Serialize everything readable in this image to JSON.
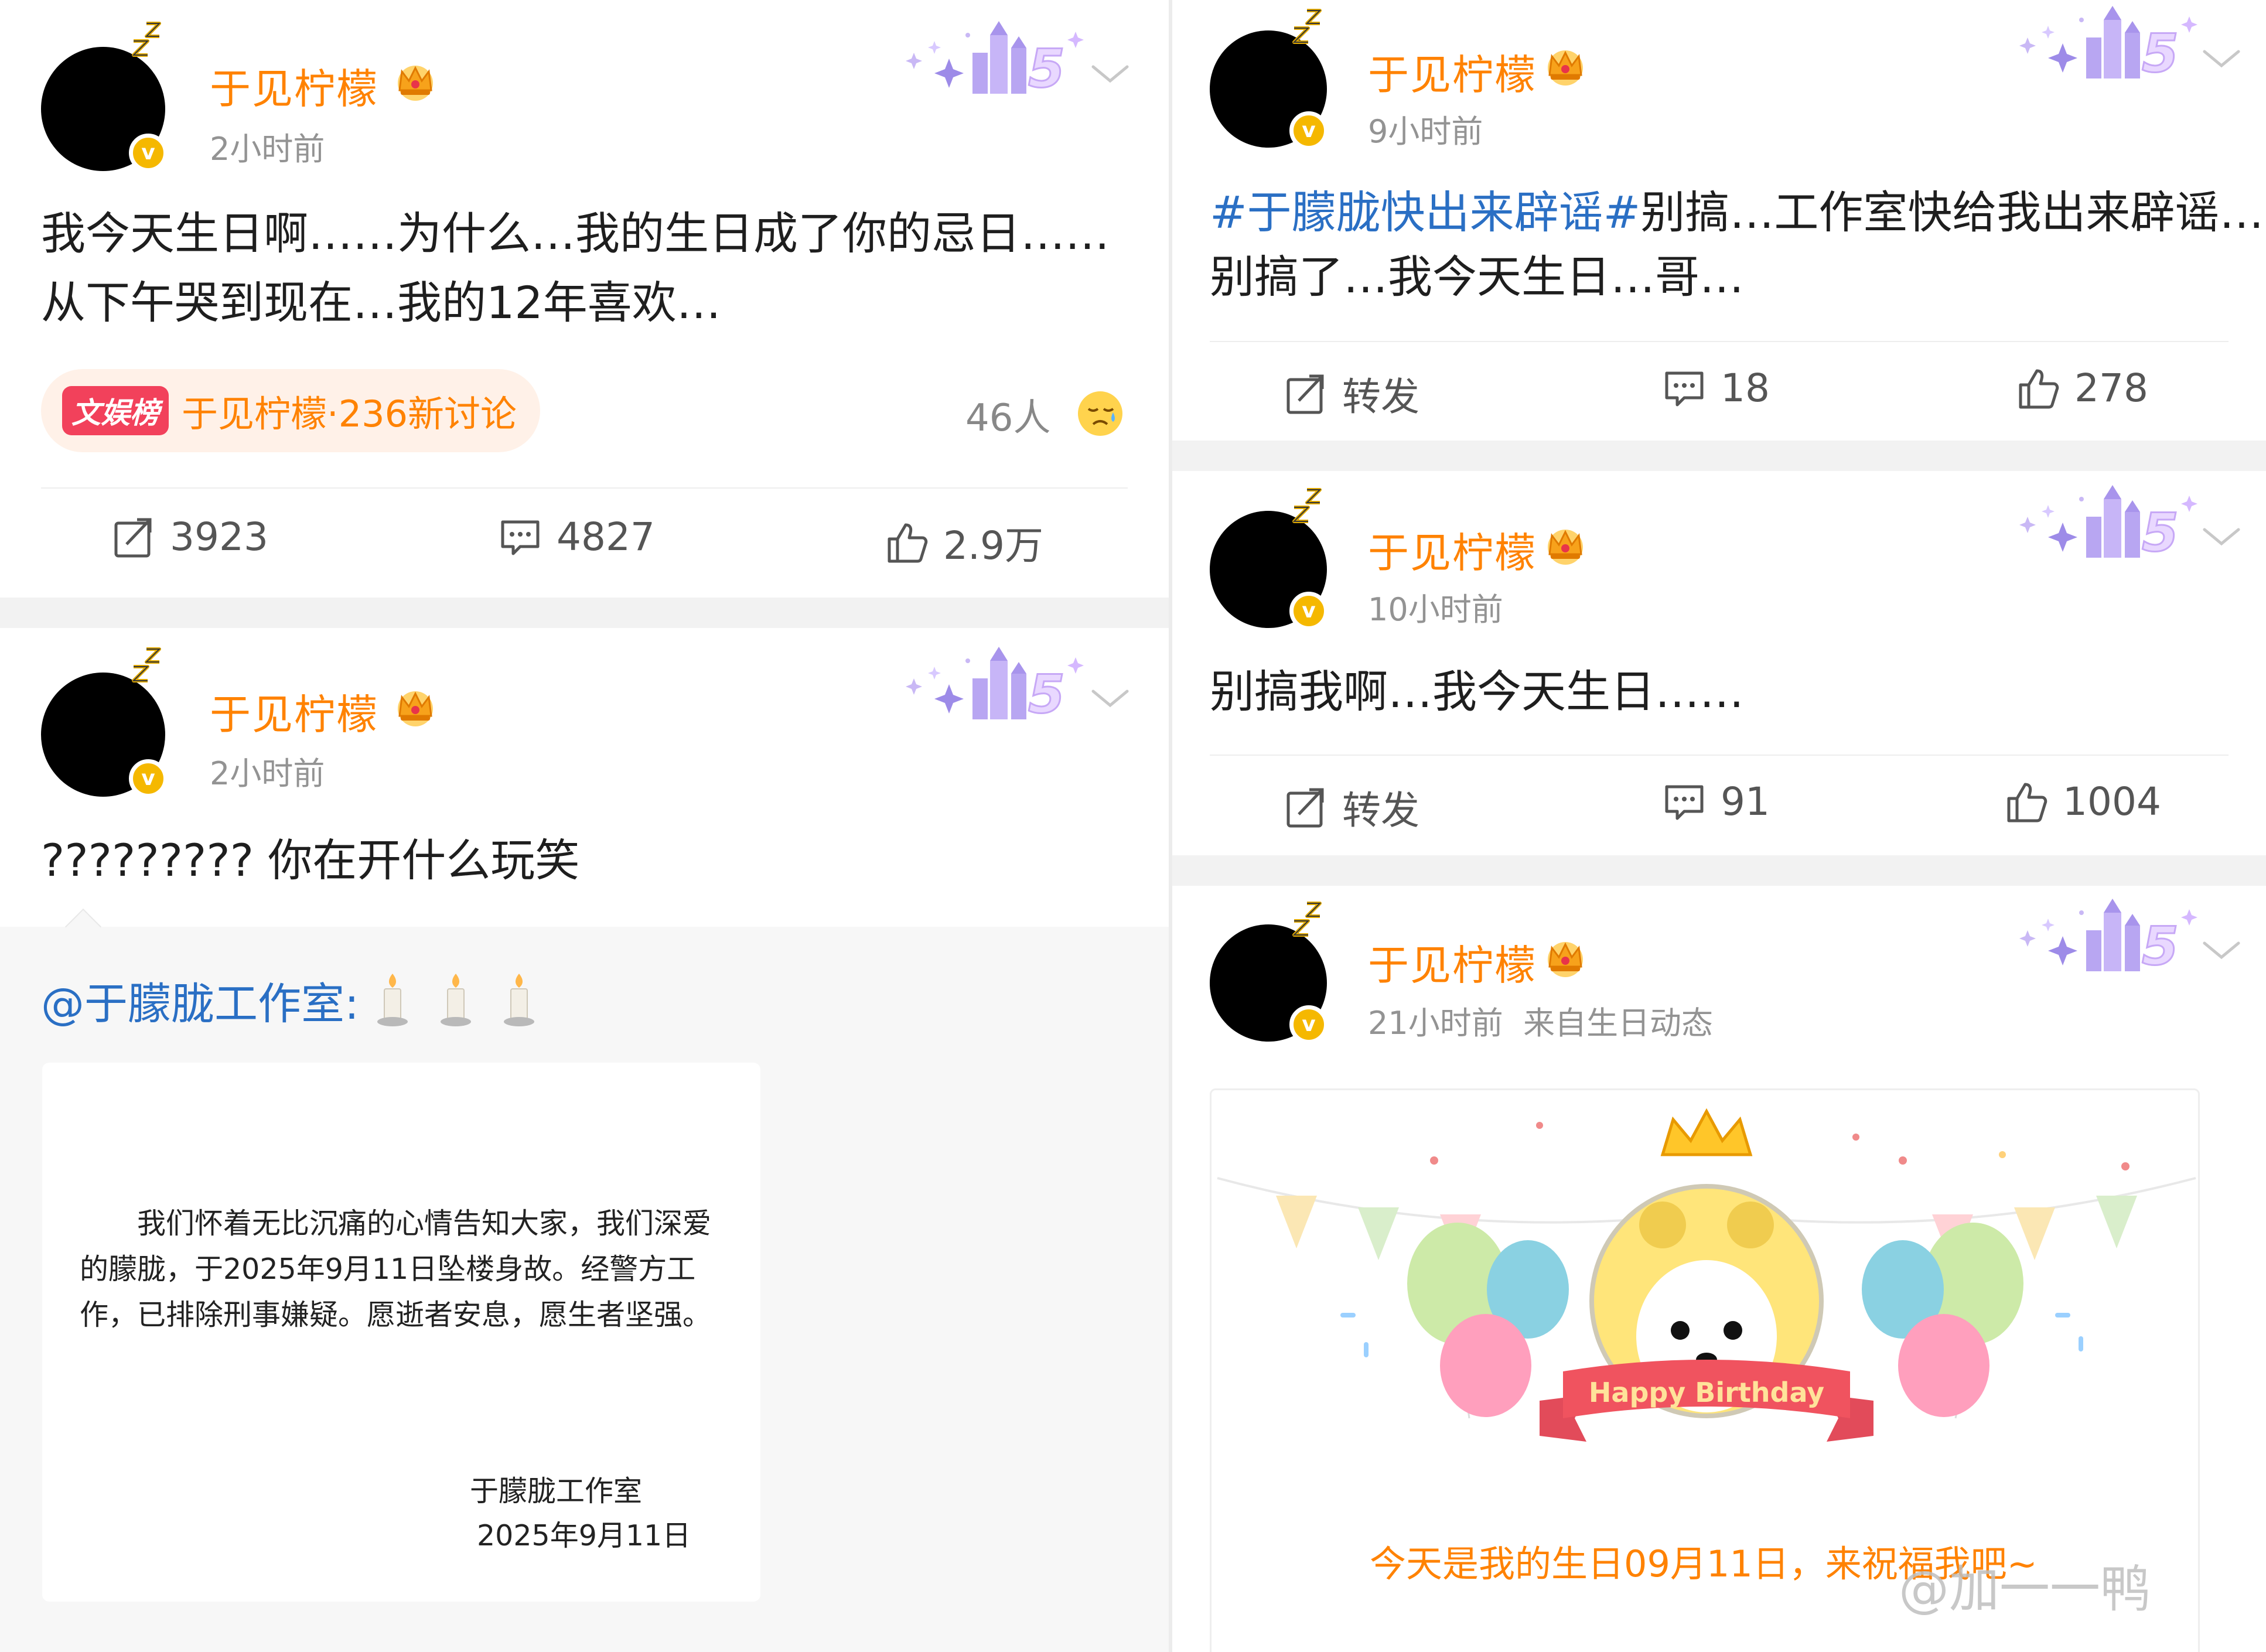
{
  "colors": {
    "username": "#ff8200",
    "topic": "#2a6fc4",
    "verified": "#f5b800",
    "trend_tag": "#f2415b"
  },
  "icons": [
    "sleep-zz-icon",
    "crown-icon",
    "verified-badge-icon",
    "chevron-down-icon",
    "repost-icon",
    "comment-icon",
    "like-icon",
    "candle-icon",
    "sad-face-icon"
  ],
  "posts": {
    "p1": {
      "username": "于见柠檬",
      "time": "2小时前",
      "text_line1": "我今天生日啊……为什么…我的生日成了你的忌日……",
      "text_line2": "从下午哭到现在…我的12年喜欢…",
      "trend_tag": "文娱榜",
      "trend_text": "于见柠檬·236新讨论",
      "viewers": "46人",
      "reposts": "3923",
      "comments": "4827",
      "likes": "2.9万"
    },
    "p2": {
      "username": "于见柠檬",
      "time": "2小时前",
      "text": "????????? 你在开什么玩笑",
      "repost_author": "@于朦胧工作室:",
      "statement": "我们怀着无比沉痛的心情告知大家，我们深爱的朦胧，于2025年9月11日坠楼身故。经警方工作，已排除刑事嫌疑。愿逝者安息，愿生者坚强。",
      "sign_name": "于朦胧工作室",
      "sign_date": "2025年9月11日"
    },
    "p3": {
      "username": "于见柠檬",
      "time": "9小时前",
      "topic": "#于朦胧快出来辟谣#",
      "text_rest": "别搞…工作室快给我出来辟谣…",
      "text_line2": "别搞了…我今天生日…哥…",
      "repost_label": "转发",
      "comments": "18",
      "likes": "278"
    },
    "p4": {
      "username": "于见柠檬",
      "time": "10小时前",
      "text": "别搞我啊…我今天生日……",
      "repost_label": "转发",
      "comments": "91",
      "likes": "1004"
    },
    "p5": {
      "username": "于见柠檬",
      "time": "21小时前",
      "source": "来自生日动态",
      "banner_label": "Happy Birthday",
      "birthday_text": "今天是我的生日09月11日，来祝福我吧~"
    }
  },
  "watermark": "@加一一鸭"
}
